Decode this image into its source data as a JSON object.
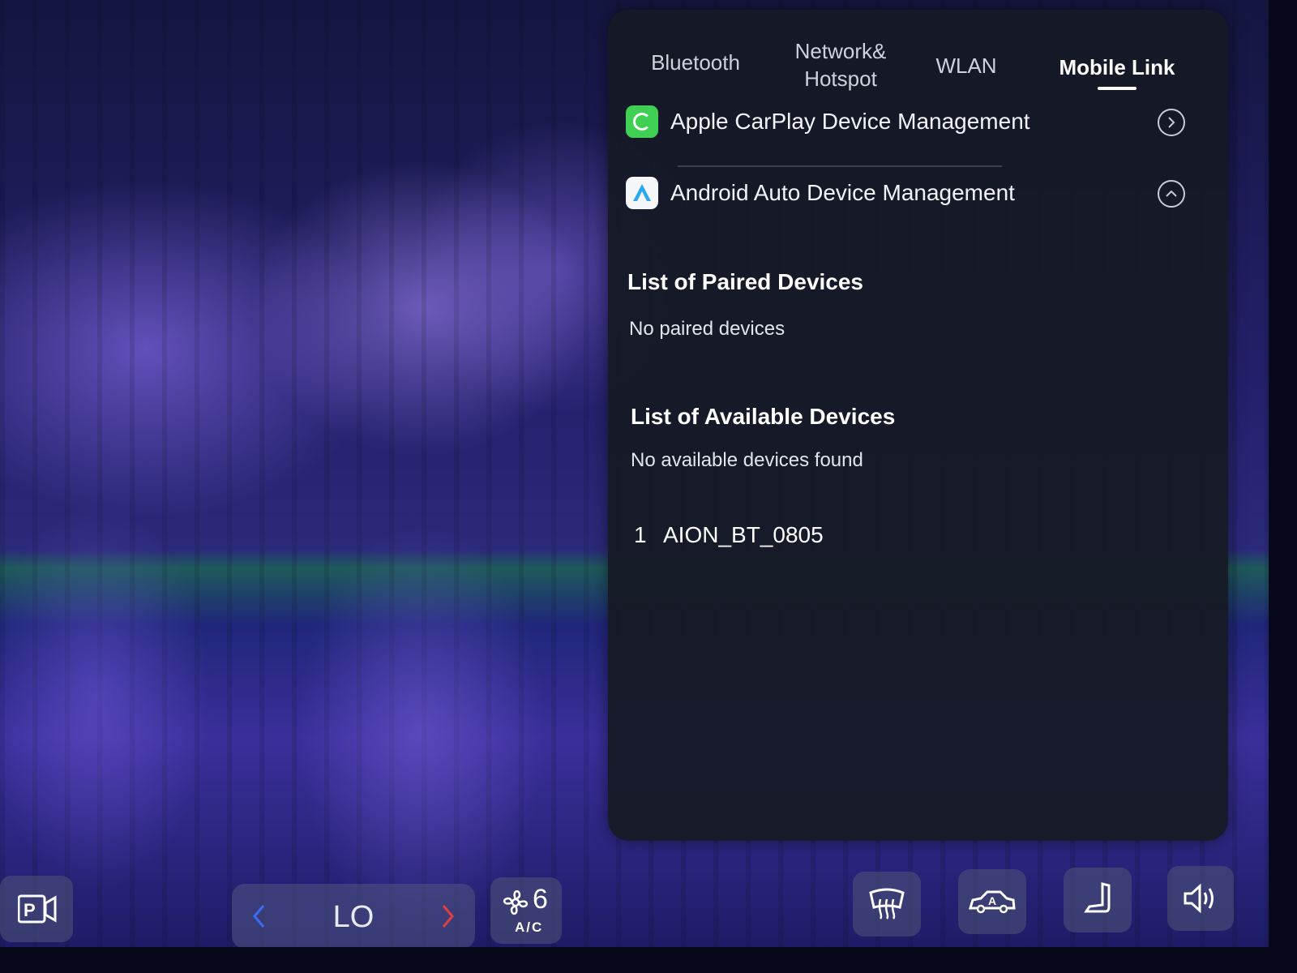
{
  "tabs": [
    {
      "label": "Bluetooth"
    },
    {
      "label": "Network&\nHotspot"
    },
    {
      "label": "WLAN"
    },
    {
      "label": "Mobile Link"
    }
  ],
  "mobile_link": {
    "carplay_label": "Apple CarPlay Device Management",
    "android_auto_label": "Android Auto Device Management",
    "paired_title": "List of Paired Devices",
    "paired_empty": "No paired devices",
    "available_title": "List of Available Devices",
    "available_empty": "No available devices found",
    "devices": [
      {
        "index": "1",
        "name": "AION_BT_0805"
      }
    ]
  },
  "bottom_bar": {
    "temperature": "LO",
    "fan_speed": "6",
    "ac_label": "A/C",
    "icons": [
      "parking-camera-icon",
      "rear-defrost-icon",
      "auto-climate-icon",
      "seat-icon",
      "volume-icon"
    ]
  },
  "colors": {
    "panel_bg": "#161a26",
    "carplay_green": "#3ecf53",
    "android_blue": "#2aa9f0",
    "arrow_left": "#3a6cf5",
    "arrow_right": "#e0403e"
  }
}
